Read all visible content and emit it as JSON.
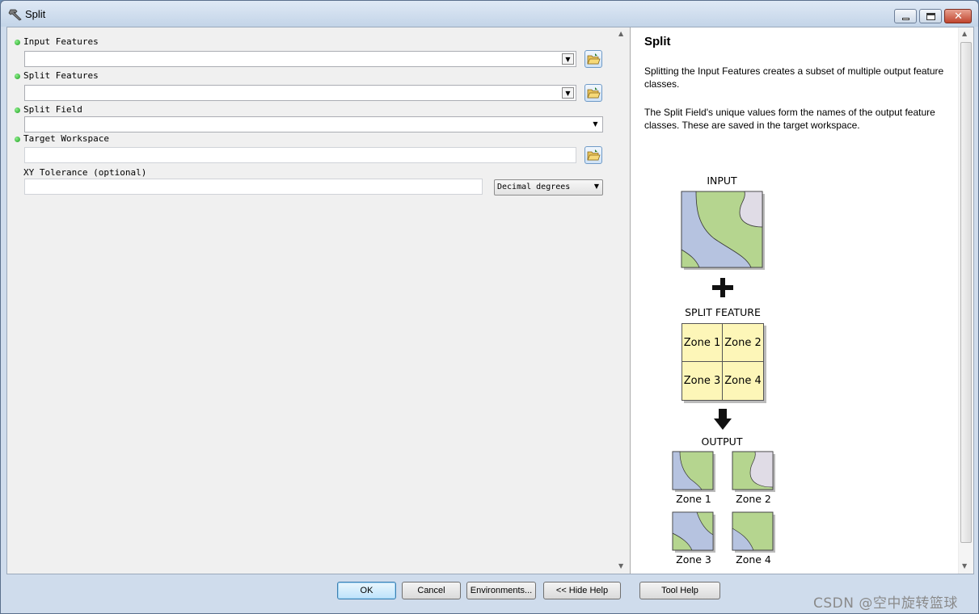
{
  "window": {
    "title": "Split"
  },
  "params": [
    {
      "label": "Input Features",
      "required": true
    },
    {
      "label": "Split Features",
      "required": true
    },
    {
      "label": "Split Field",
      "required": true
    },
    {
      "label": "Target Workspace",
      "required": true
    },
    {
      "label": "XY Tolerance (optional)",
      "required": false
    }
  ],
  "xy_units": "Decimal degrees",
  "help": {
    "title": "Split",
    "para1": "Splitting the Input Features creates a subset of multiple output feature classes.",
    "para2": "The Split Field's unique values form the names of the output feature classes. These are saved in the target workspace.",
    "diagram": {
      "input_label": "INPUT",
      "split_label": "SPLIT FEATURE",
      "output_label": "OUTPUT",
      "zones": [
        "Zone 1",
        "Zone 2",
        "Zone 3",
        "Zone 4"
      ],
      "colors": {
        "green": "#b5d58f",
        "blue": "#b6c3e0",
        "lavender": "#e0dce6",
        "yellow": "#fdf6b8"
      }
    }
  },
  "buttons": {
    "ok": "OK",
    "cancel": "Cancel",
    "environments": "Environments...",
    "hide_help": "<< Hide Help",
    "tool_help": "Tool Help"
  },
  "watermark": "CSDN @空中旋转篮球"
}
